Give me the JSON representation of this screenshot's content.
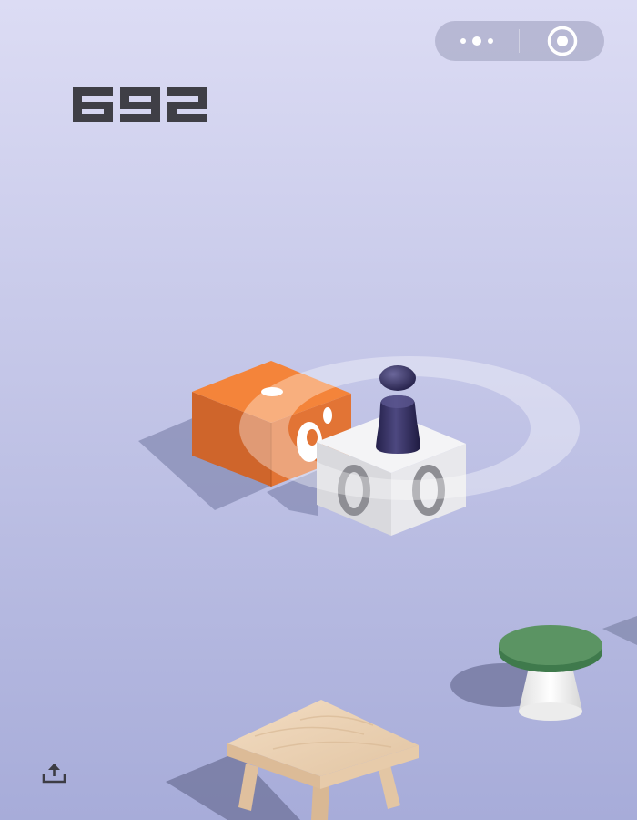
{
  "score": {
    "value": "692",
    "color": "#3f3f46"
  },
  "capsule": {
    "menu_icon": "more-dots-icon",
    "close_icon": "target-circle-icon"
  },
  "share": {
    "icon": "share-upload-icon",
    "color": "#3c3c44"
  },
  "scene": {
    "background_top": "#dcdcf4",
    "background_bottom": "#a7acd9",
    "objects": [
      "orange-box-platform",
      "white-cube-platform",
      "player-piece",
      "green-round-stool",
      "wooden-stool",
      "target-ring"
    ],
    "colors": {
      "orange_top": "#f4843a",
      "orange_left": "#cf652b",
      "orange_right": "#e27435",
      "white_top": "#f4f4f6",
      "white_left": "#d9d9dd",
      "white_right": "#e8e8ec",
      "player": "#2e2a55",
      "green": "#5b9463",
      "wood": "#e8cfb1"
    }
  }
}
